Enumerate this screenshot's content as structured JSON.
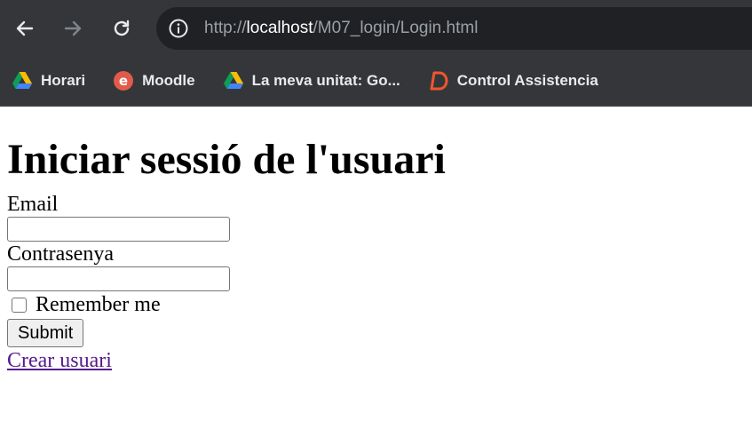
{
  "browser": {
    "url_scheme": "http://",
    "url_host": "localhost",
    "url_path": "/M07_login/Login.html",
    "back_icon": "arrow-left-icon",
    "forward_icon": "arrow-right-icon",
    "reload_icon": "reload-icon",
    "info_icon": "info-icon"
  },
  "bookmarks": [
    {
      "label": "Horari",
      "icon": "google-drive-icon"
    },
    {
      "label": "Moodle",
      "icon": "moodle-icon"
    },
    {
      "label": "La meva unitat: Go...",
      "icon": "google-drive-icon"
    },
    {
      "label": "Control Assistencia",
      "icon": "d-logo-icon"
    }
  ],
  "page": {
    "title": "Iniciar sessió de l'usuari",
    "email_label": "Email",
    "email_value": "",
    "password_label": "Contrasenya",
    "password_value": "",
    "remember_label": "Remember me",
    "remember_checked": false,
    "submit_label": "Submit",
    "create_link_label": "Crear usuari"
  },
  "colors": {
    "chrome_bg": "#35363a",
    "omnibox_bg": "#202124",
    "visited_link": "#551a8b"
  }
}
